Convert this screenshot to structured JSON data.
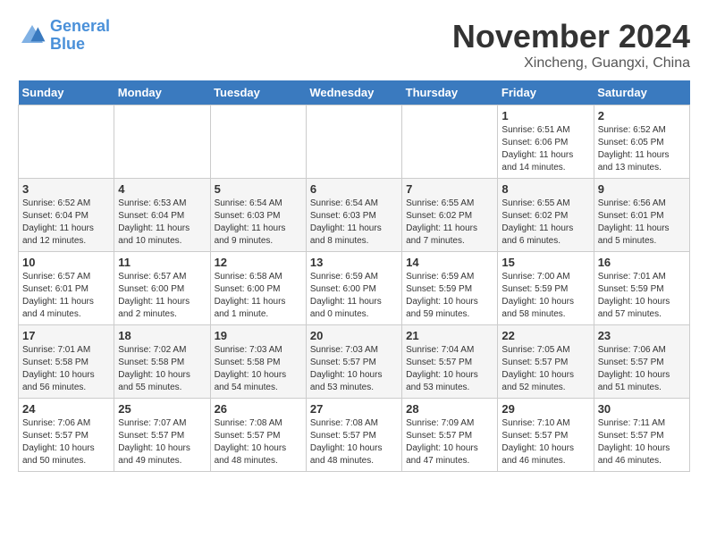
{
  "header": {
    "logo_line1": "General",
    "logo_line2": "Blue",
    "month": "November 2024",
    "location": "Xincheng, Guangxi, China"
  },
  "weekdays": [
    "Sunday",
    "Monday",
    "Tuesday",
    "Wednesday",
    "Thursday",
    "Friday",
    "Saturday"
  ],
  "weeks": [
    [
      {
        "day": "",
        "sunrise": "",
        "sunset": "",
        "daylight": ""
      },
      {
        "day": "",
        "sunrise": "",
        "sunset": "",
        "daylight": ""
      },
      {
        "day": "",
        "sunrise": "",
        "sunset": "",
        "daylight": ""
      },
      {
        "day": "",
        "sunrise": "",
        "sunset": "",
        "daylight": ""
      },
      {
        "day": "",
        "sunrise": "",
        "sunset": "",
        "daylight": ""
      },
      {
        "day": "1",
        "sunrise": "Sunrise: 6:51 AM",
        "sunset": "Sunset: 6:06 PM",
        "daylight": "Daylight: 11 hours and 14 minutes."
      },
      {
        "day": "2",
        "sunrise": "Sunrise: 6:52 AM",
        "sunset": "Sunset: 6:05 PM",
        "daylight": "Daylight: 11 hours and 13 minutes."
      }
    ],
    [
      {
        "day": "3",
        "sunrise": "Sunrise: 6:52 AM",
        "sunset": "Sunset: 6:04 PM",
        "daylight": "Daylight: 11 hours and 12 minutes."
      },
      {
        "day": "4",
        "sunrise": "Sunrise: 6:53 AM",
        "sunset": "Sunset: 6:04 PM",
        "daylight": "Daylight: 11 hours and 10 minutes."
      },
      {
        "day": "5",
        "sunrise": "Sunrise: 6:54 AM",
        "sunset": "Sunset: 6:03 PM",
        "daylight": "Daylight: 11 hours and 9 minutes."
      },
      {
        "day": "6",
        "sunrise": "Sunrise: 6:54 AM",
        "sunset": "Sunset: 6:03 PM",
        "daylight": "Daylight: 11 hours and 8 minutes."
      },
      {
        "day": "7",
        "sunrise": "Sunrise: 6:55 AM",
        "sunset": "Sunset: 6:02 PM",
        "daylight": "Daylight: 11 hours and 7 minutes."
      },
      {
        "day": "8",
        "sunrise": "Sunrise: 6:55 AM",
        "sunset": "Sunset: 6:02 PM",
        "daylight": "Daylight: 11 hours and 6 minutes."
      },
      {
        "day": "9",
        "sunrise": "Sunrise: 6:56 AM",
        "sunset": "Sunset: 6:01 PM",
        "daylight": "Daylight: 11 hours and 5 minutes."
      }
    ],
    [
      {
        "day": "10",
        "sunrise": "Sunrise: 6:57 AM",
        "sunset": "Sunset: 6:01 PM",
        "daylight": "Daylight: 11 hours and 4 minutes."
      },
      {
        "day": "11",
        "sunrise": "Sunrise: 6:57 AM",
        "sunset": "Sunset: 6:00 PM",
        "daylight": "Daylight: 11 hours and 2 minutes."
      },
      {
        "day": "12",
        "sunrise": "Sunrise: 6:58 AM",
        "sunset": "Sunset: 6:00 PM",
        "daylight": "Daylight: 11 hours and 1 minute."
      },
      {
        "day": "13",
        "sunrise": "Sunrise: 6:59 AM",
        "sunset": "Sunset: 6:00 PM",
        "daylight": "Daylight: 11 hours and 0 minutes."
      },
      {
        "day": "14",
        "sunrise": "Sunrise: 6:59 AM",
        "sunset": "Sunset: 5:59 PM",
        "daylight": "Daylight: 10 hours and 59 minutes."
      },
      {
        "day": "15",
        "sunrise": "Sunrise: 7:00 AM",
        "sunset": "Sunset: 5:59 PM",
        "daylight": "Daylight: 10 hours and 58 minutes."
      },
      {
        "day": "16",
        "sunrise": "Sunrise: 7:01 AM",
        "sunset": "Sunset: 5:59 PM",
        "daylight": "Daylight: 10 hours and 57 minutes."
      }
    ],
    [
      {
        "day": "17",
        "sunrise": "Sunrise: 7:01 AM",
        "sunset": "Sunset: 5:58 PM",
        "daylight": "Daylight: 10 hours and 56 minutes."
      },
      {
        "day": "18",
        "sunrise": "Sunrise: 7:02 AM",
        "sunset": "Sunset: 5:58 PM",
        "daylight": "Daylight: 10 hours and 55 minutes."
      },
      {
        "day": "19",
        "sunrise": "Sunrise: 7:03 AM",
        "sunset": "Sunset: 5:58 PM",
        "daylight": "Daylight: 10 hours and 54 minutes."
      },
      {
        "day": "20",
        "sunrise": "Sunrise: 7:03 AM",
        "sunset": "Sunset: 5:57 PM",
        "daylight": "Daylight: 10 hours and 53 minutes."
      },
      {
        "day": "21",
        "sunrise": "Sunrise: 7:04 AM",
        "sunset": "Sunset: 5:57 PM",
        "daylight": "Daylight: 10 hours and 53 minutes."
      },
      {
        "day": "22",
        "sunrise": "Sunrise: 7:05 AM",
        "sunset": "Sunset: 5:57 PM",
        "daylight": "Daylight: 10 hours and 52 minutes."
      },
      {
        "day": "23",
        "sunrise": "Sunrise: 7:06 AM",
        "sunset": "Sunset: 5:57 PM",
        "daylight": "Daylight: 10 hours and 51 minutes."
      }
    ],
    [
      {
        "day": "24",
        "sunrise": "Sunrise: 7:06 AM",
        "sunset": "Sunset: 5:57 PM",
        "daylight": "Daylight: 10 hours and 50 minutes."
      },
      {
        "day": "25",
        "sunrise": "Sunrise: 7:07 AM",
        "sunset": "Sunset: 5:57 PM",
        "daylight": "Daylight: 10 hours and 49 minutes."
      },
      {
        "day": "26",
        "sunrise": "Sunrise: 7:08 AM",
        "sunset": "Sunset: 5:57 PM",
        "daylight": "Daylight: 10 hours and 48 minutes."
      },
      {
        "day": "27",
        "sunrise": "Sunrise: 7:08 AM",
        "sunset": "Sunset: 5:57 PM",
        "daylight": "Daylight: 10 hours and 48 minutes."
      },
      {
        "day": "28",
        "sunrise": "Sunrise: 7:09 AM",
        "sunset": "Sunset: 5:57 PM",
        "daylight": "Daylight: 10 hours and 47 minutes."
      },
      {
        "day": "29",
        "sunrise": "Sunrise: 7:10 AM",
        "sunset": "Sunset: 5:57 PM",
        "daylight": "Daylight: 10 hours and 46 minutes."
      },
      {
        "day": "30",
        "sunrise": "Sunrise: 7:11 AM",
        "sunset": "Sunset: 5:57 PM",
        "daylight": "Daylight: 10 hours and 46 minutes."
      }
    ]
  ]
}
